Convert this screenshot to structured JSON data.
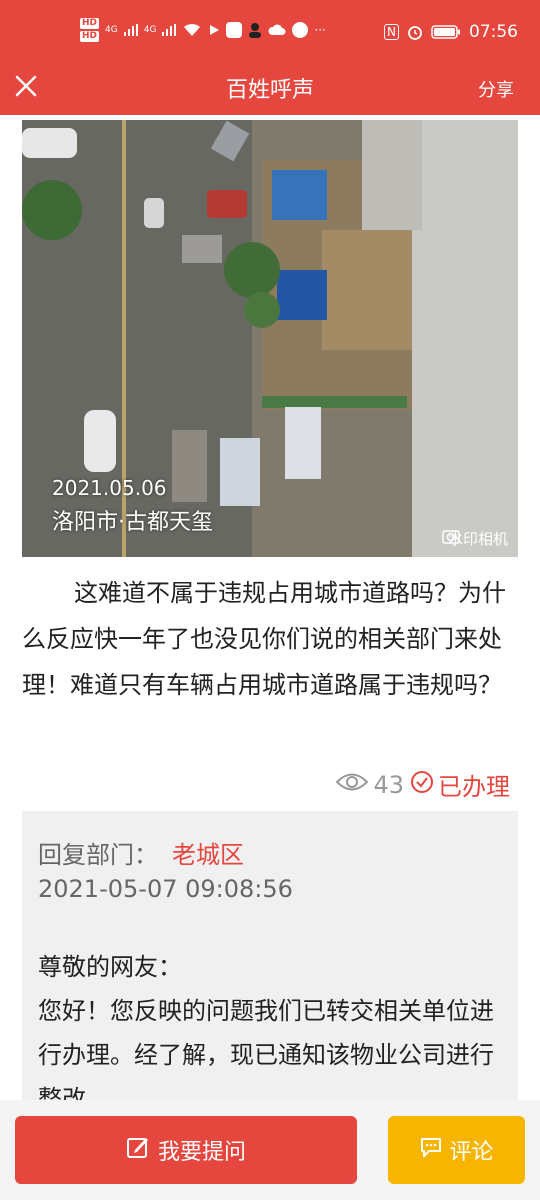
{
  "status_bar": {
    "hd1": "HD",
    "hd2": "HD",
    "sig1": "4G",
    "sig2": "4G",
    "more": "···",
    "nfc": "N",
    "time": "07:56"
  },
  "header": {
    "title": "百姓呼声",
    "share_label": "分享"
  },
  "photo": {
    "date_stamp": "2021.05.06",
    "location_stamp": "洛阳市·古都天玺",
    "watermark_app": "水印相机"
  },
  "post": {
    "body": "这难道不属于违规占用城市道路吗？为什么反应快一年了也没见你们说的相关部门来处理！难道只有车辆占用城市道路属于违规吗？",
    "views": "43",
    "status": "已办理"
  },
  "reply": {
    "dept_label": "回复部门：",
    "dept_name": "老城区",
    "timestamp": "2021-05-07 09:08:56",
    "greeting": "尊敬的网友：",
    "body": "您好！您反映的问题我们已转交相关单位进行办理。经了解，现已通知该物业公司进行整改。"
  },
  "bottom_bar": {
    "ask_label": "我要提问",
    "comment_label": "评论"
  },
  "colors": {
    "brand_red": "#e5473f",
    "comment_yellow": "#f7b500"
  }
}
